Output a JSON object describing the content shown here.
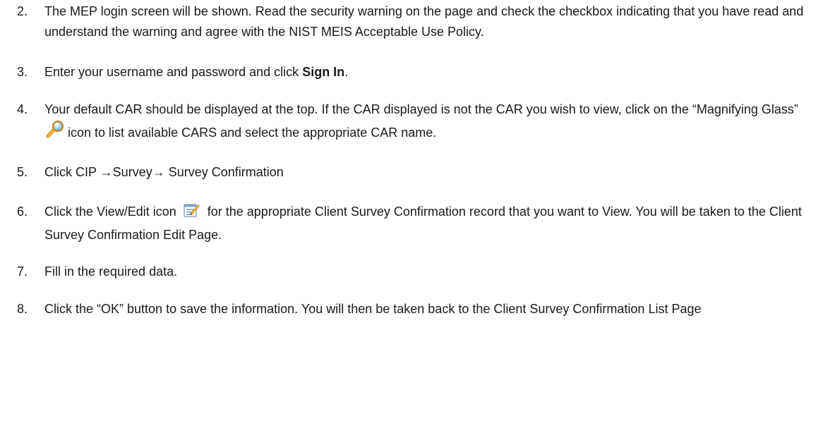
{
  "steps": [
    {
      "num": "2.",
      "text": "The MEP login screen will be shown. Read the security warning on the page and check the checkbox indicating that you have read and understand the warning and agree with the NIST MEIS Acceptable Use Policy."
    },
    {
      "num": "3.",
      "text_before": "Enter your username and password and click ",
      "bold": "Sign In",
      "text_after": "."
    },
    {
      "num": "4.",
      "text_before": "Your default CAR should be displayed at the top. If the CAR displayed is not the CAR you wish to view, click on the “Magnifying Glass”",
      "icon": "magnifying-glass-icon",
      "text_after": "icon to list available CARS and select the appropriate CAR name."
    },
    {
      "num": "5.",
      "text": "Click CIP →Survey→ Survey Confirmation"
    },
    {
      "num": "6.",
      "text_before": "Click the View/Edit icon",
      "icon": "view-edit-icon",
      "text_after": "for the appropriate Client Survey Confirmation record that you want to View. You will be taken to the Client Survey Confirmation Edit Page."
    },
    {
      "num": "7.",
      "text": "Fill in the required data."
    },
    {
      "num": "8.",
      "text": "Click the “OK” button to save the information. You will then be taken back to the Client Survey Confirmation List Page"
    }
  ]
}
